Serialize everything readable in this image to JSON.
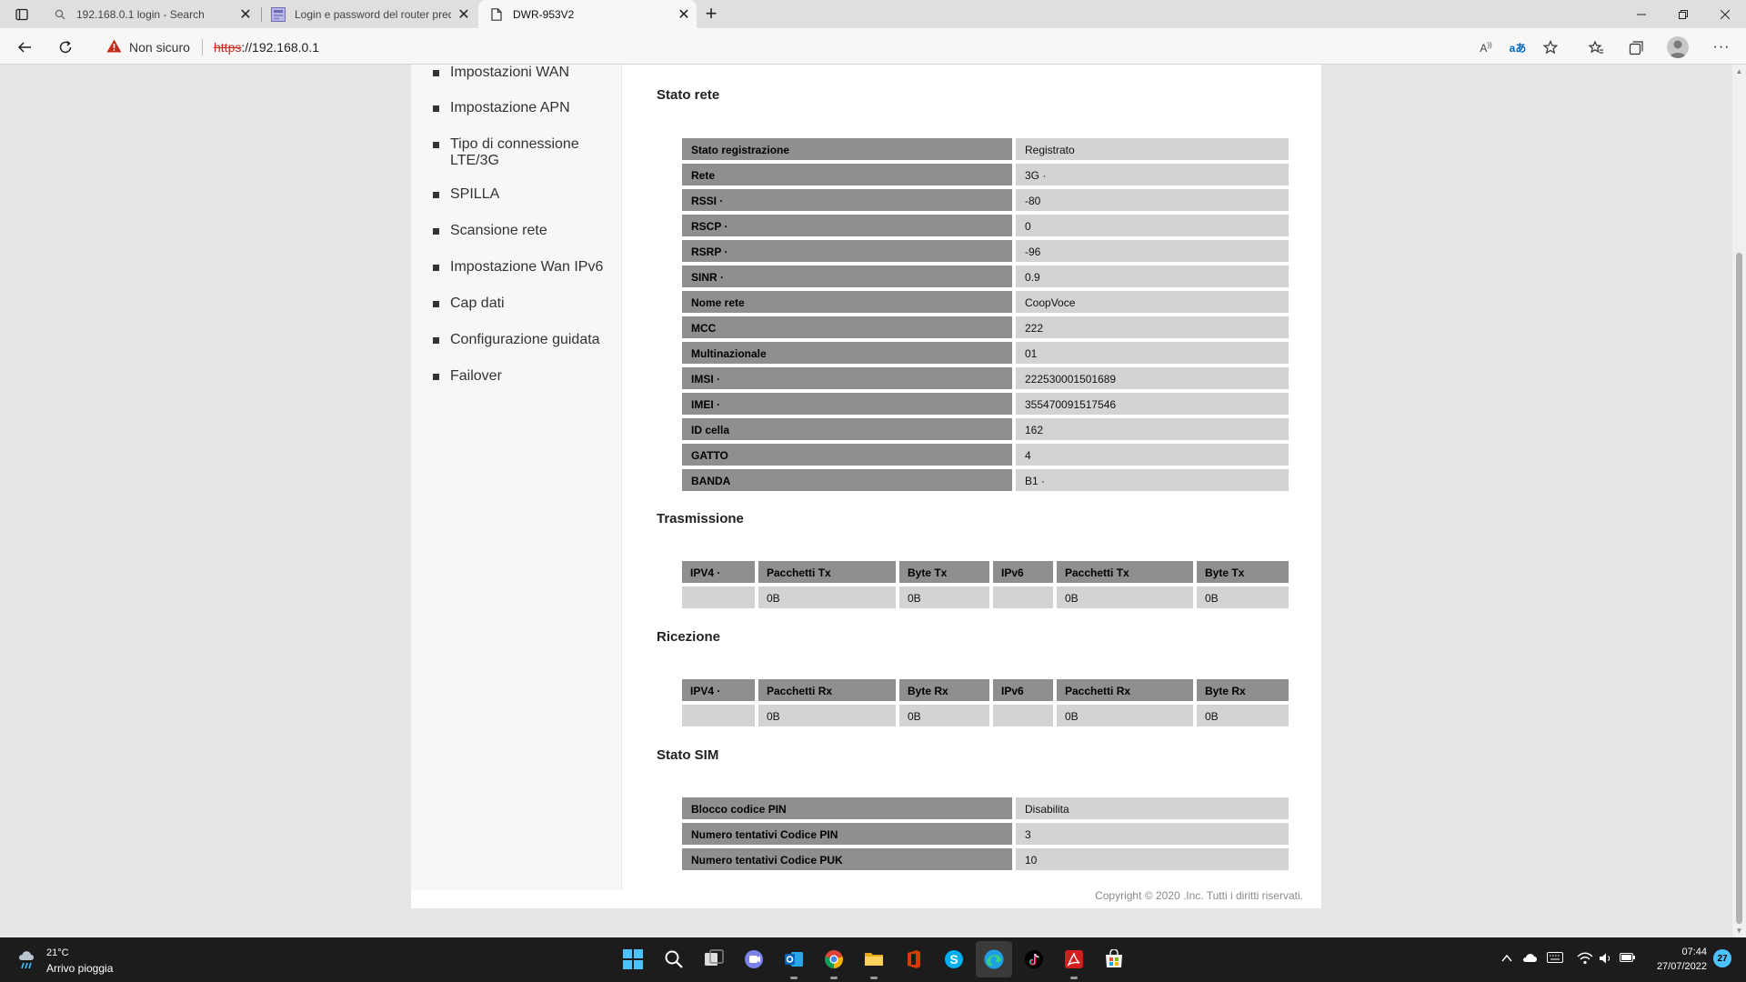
{
  "browser": {
    "tabs": [
      {
        "title": "192.168.0.1 login - Search",
        "icon": "search-icon"
      },
      {
        "title": "Login e password del router predefiniti",
        "icon": "site-favicon"
      },
      {
        "title": "DWR-953V2",
        "icon": "page-icon",
        "active": true
      }
    ],
    "security_label": "Non sicuro",
    "url_scheme": "https",
    "url_rest": "://192.168.0.1"
  },
  "sidebar": {
    "items": [
      {
        "label": "Impostazioni WAN"
      },
      {
        "label": "Impostazione APN"
      },
      {
        "label": "Tipo di connessione LTE/3G"
      },
      {
        "label": "SPILLA"
      },
      {
        "label": "Scansione rete"
      },
      {
        "label": "Impostazione Wan IPv6"
      },
      {
        "label": "Cap dati"
      },
      {
        "label": "Configurazione guidata"
      },
      {
        "label": "Failover"
      }
    ]
  },
  "network_status": {
    "title": "Stato rete",
    "rows": [
      {
        "label": "Stato registrazione",
        "value": "Registrato"
      },
      {
        "label": "Rete",
        "value": "3G ·"
      },
      {
        "label": "RSSI ·",
        "value": "-80"
      },
      {
        "label": "RSCP ·",
        "value": "0"
      },
      {
        "label": "RSRP ·",
        "value": "-96"
      },
      {
        "label": "SINR ·",
        "value": "0.9"
      },
      {
        "label": "Nome rete",
        "value": "CoopVoce"
      },
      {
        "label": "MCC",
        "value": "222"
      },
      {
        "label": "Multinazionale",
        "value": "01"
      },
      {
        "label": "IMSI ·",
        "value": "222530001501689"
      },
      {
        "label": "IMEI ·",
        "value": "355470091517546"
      },
      {
        "label": "ID cella",
        "value": "162"
      },
      {
        "label": "GATTO",
        "value": "4"
      },
      {
        "label": "BANDA",
        "value": "B1 ·"
      }
    ]
  },
  "transmission": {
    "title": "Trasmissione",
    "headers": [
      "IPV4 ·",
      "Pacchetti Tx",
      "Byte Tx",
      "IPv6",
      "Pacchetti Tx",
      "Byte Tx"
    ],
    "values": [
      "",
      "0B",
      "0B",
      "",
      "0B",
      "0B"
    ]
  },
  "reception": {
    "title": "Ricezione",
    "headers": [
      "IPV4 ·",
      "Pacchetti Rx",
      "Byte Rx",
      "IPv6",
      "Pacchetti Rx",
      "Byte Rx"
    ],
    "values": [
      "",
      "0B",
      "0B",
      "",
      "0B",
      "0B"
    ]
  },
  "sim_status": {
    "title": "Stato SIM",
    "rows": [
      {
        "label": "Blocco codice PIN",
        "value": "Disabilita"
      },
      {
        "label": "Numero tentativi Codice PIN",
        "value": "3"
      },
      {
        "label": "Numero tentativi Codice PUK",
        "value": "10"
      }
    ]
  },
  "footer": {
    "copyright": "Copyright © 2020 .Inc. Tutti i diritti riservati."
  },
  "taskbar": {
    "weather_temp": "21°C",
    "weather_desc": "Arrivo pioggia",
    "time": "07:44",
    "date": "27/07/2022",
    "notifications": "27",
    "apps": [
      "start-icon",
      "search-icon",
      "task-view-icon",
      "chat-icon",
      "outlook-icon",
      "chrome-icon",
      "file-explorer-icon",
      "office-icon",
      "skype-icon",
      "edge-icon",
      "tiktok-icon",
      "acrobat-icon",
      "store-icon"
    ]
  },
  "colors": {
    "header_cell": "#8f8f8f",
    "value_cell": "#d3d3d3",
    "page_bg": "#e5e5e5",
    "taskbar_bg": "#1c1c1c",
    "insecure_red": "#c42b1c"
  }
}
